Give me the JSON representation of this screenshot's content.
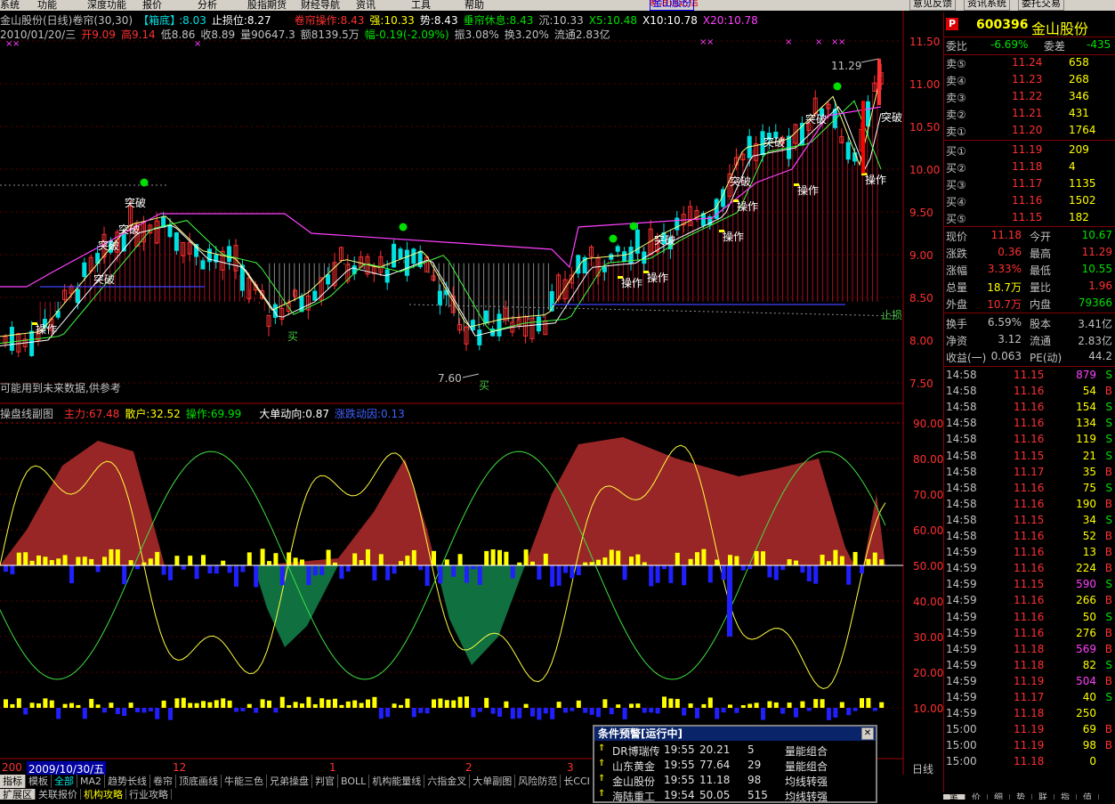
{
  "menu": {
    "items": [
      "系统",
      "功能",
      "深度功能",
      "报价",
      "分析",
      "股指期货",
      "财经导航",
      "资讯",
      "工具",
      "帮助"
    ],
    "center_title": "新浪通达信",
    "center_stock": "金山股份",
    "buttons": [
      "意见反馈",
      "资讯系统",
      "委托交易"
    ]
  },
  "header": {
    "stock_title": "金山股份(日线)",
    "indicator_name": "卷帘(30,30)",
    "box_label": "【箱底】",
    "box_value": ":8.03",
    "stop_loss": "止损位:8.27",
    "op_label": "卷帘操作:8.43",
    "strong": "强:10.33",
    "trend": "势:8.43",
    "rest": "垂帘休息:8.43",
    "sink": "沉:10.33",
    "x5": "X5:10.48",
    "x10": "X10:10.78",
    "x20": "X20:10.78",
    "date": "2010/01/20/三",
    "open": "开9.09",
    "high": "高9.14",
    "low": "低8.86",
    "close": "收8.89",
    "vol": "量90647.3",
    "amount": "额8139.5万",
    "change": "幅-0.19(-2.09%)",
    "amp": "振3.08%",
    "turnover": "换3.20%",
    "float": "流通2.83亿"
  },
  "main_chart": {
    "price_ticks": [
      "11.50",
      "11.00",
      "10.50",
      "10.00",
      "9.50",
      "9.00",
      "8.50",
      "8.00",
      "7.50"
    ],
    "labels": {
      "breakout": "突破",
      "operate": "操作",
      "buy": "买",
      "stop_loss_tag": "止损",
      "high_mark": "11.29",
      "low_mark": "7.60",
      "future_note": "可能用到未来数据,供参考"
    }
  },
  "sub_chart": {
    "title": "操盘线副图",
    "main_force": "主力:67.48",
    "retail": "散户:32.52",
    "operate": "操作:69.99",
    "big_order": "大单动向:0.87",
    "price_momentum": "涨跌动因:0.13",
    "ticks": [
      "90.00",
      "80.00",
      "70.00",
      "60.00",
      "50.00",
      "40.00",
      "30.00",
      "20.00",
      "10.00"
    ]
  },
  "time_axis": {
    "date_label": "2009/10/30/五",
    "left_stub": "200",
    "months": [
      "12",
      "1",
      "2",
      "3"
    ],
    "period": "日线"
  },
  "tabs_row1": [
    "指标",
    "模板",
    "全部",
    "MA2",
    "趋势长线",
    "卷帘",
    "顶底画线",
    "牛能三色",
    "兄弟操盘",
    "判官",
    "BOLL",
    "机构能量线",
    "六指金叉",
    "大单副图",
    "风险防范",
    "长CCI"
  ],
  "tabs_row2": [
    "扩展区",
    "关联报价",
    "机构攻略",
    "行业攻略"
  ],
  "right_panel": {
    "code": "600396",
    "name": "金山股份",
    "wei_bi_label": "委比",
    "wei_bi": "-6.69%",
    "wei_cha_label": "委差",
    "wei_cha": "-435",
    "asks": [
      {
        "label": "卖⑤",
        "price": "11.24",
        "vol": "658"
      },
      {
        "label": "卖④",
        "price": "11.23",
        "vol": "268"
      },
      {
        "label": "卖③",
        "price": "11.22",
        "vol": "346"
      },
      {
        "label": "卖②",
        "price": "11.21",
        "vol": "431"
      },
      {
        "label": "卖①",
        "price": "11.20",
        "vol": "1764"
      }
    ],
    "bids": [
      {
        "label": "买①",
        "price": "11.19",
        "vol": "209"
      },
      {
        "label": "买②",
        "price": "11.18",
        "vol": "4"
      },
      {
        "label": "买③",
        "price": "11.17",
        "vol": "1135"
      },
      {
        "label": "买④",
        "price": "11.16",
        "vol": "1502"
      },
      {
        "label": "买⑤",
        "price": "11.15",
        "vol": "182"
      }
    ],
    "quote": [
      {
        "l1": "现价",
        "v1": "11.18",
        "l2": "今开",
        "v2": "10.67"
      },
      {
        "l1": "涨跌",
        "v1": "0.36",
        "l2": "最高",
        "v2": "11.29"
      },
      {
        "l1": "涨幅",
        "v1": "3.33%",
        "l2": "最低",
        "v2": "10.55"
      },
      {
        "l1": "总量",
        "v1": "18.7万",
        "l2": "量比",
        "v2": "1.96"
      },
      {
        "l1": "外盘",
        "v1": "10.7万",
        "l2": "内盘",
        "v2": "79366"
      }
    ],
    "fund": [
      {
        "l1": "换手",
        "v1": "6.59%",
        "l2": "股本",
        "v2": "3.41亿"
      },
      {
        "l1": "净资",
        "v1": "3.12",
        "l2": "流通",
        "v2": "2.83亿"
      },
      {
        "l1": "收益(一)",
        "v1": "0.063",
        "l2": "PE(动)",
        "v2": "44.2"
      }
    ],
    "ticks": [
      {
        "t": "14:58",
        "p": "11.15",
        "v": "879",
        "s": "S"
      },
      {
        "t": "14:58",
        "p": "11.16",
        "v": "54",
        "s": "B"
      },
      {
        "t": "14:58",
        "p": "11.16",
        "v": "154",
        "s": "S"
      },
      {
        "t": "14:58",
        "p": "11.16",
        "v": "134",
        "s": "S"
      },
      {
        "t": "14:58",
        "p": "11.16",
        "v": "119",
        "s": "S"
      },
      {
        "t": "14:58",
        "p": "11.15",
        "v": "21",
        "s": "S"
      },
      {
        "t": "14:58",
        "p": "11.17",
        "v": "35",
        "s": "B"
      },
      {
        "t": "14:58",
        "p": "11.16",
        "v": "75",
        "s": "S"
      },
      {
        "t": "14:58",
        "p": "11.16",
        "v": "190",
        "s": "B"
      },
      {
        "t": "14:58",
        "p": "11.15",
        "v": "34",
        "s": "S"
      },
      {
        "t": "14:58",
        "p": "11.16",
        "v": "52",
        "s": "B"
      },
      {
        "t": "14:59",
        "p": "11.16",
        "v": "13",
        "s": "B"
      },
      {
        "t": "14:59",
        "p": "11.16",
        "v": "224",
        "s": "B"
      },
      {
        "t": "14:59",
        "p": "11.15",
        "v": "590",
        "s": "S"
      },
      {
        "t": "14:59",
        "p": "11.16",
        "v": "266",
        "s": "B"
      },
      {
        "t": "14:59",
        "p": "11.16",
        "v": "50",
        "s": "S"
      },
      {
        "t": "14:59",
        "p": "11.16",
        "v": "276",
        "s": "B"
      },
      {
        "t": "14:59",
        "p": "11.18",
        "v": "569",
        "s": "B"
      },
      {
        "t": "14:59",
        "p": "11.18",
        "v": "82",
        "s": "S"
      },
      {
        "t": "14:59",
        "p": "11.19",
        "v": "504",
        "s": "B"
      },
      {
        "t": "14:59",
        "p": "11.17",
        "v": "40",
        "s": "S"
      },
      {
        "t": "14:59",
        "p": "11.18",
        "v": "250",
        "s": ""
      },
      {
        "t": "15:00",
        "p": "11.19",
        "v": "69",
        "s": "B"
      },
      {
        "t": "15:00",
        "p": "11.19",
        "v": "98",
        "s": "B"
      },
      {
        "t": "15:00",
        "p": "11.18",
        "v": "0",
        "s": ""
      }
    ],
    "bottom_tabs": [
      "笔",
      "价",
      "细",
      "势",
      "联",
      "指",
      "值"
    ]
  },
  "alert": {
    "title": "条件预警[运行中]",
    "rows": [
      {
        "name": "DR博瑞传",
        "time": "19:55",
        "price": "20.21",
        "num": "5",
        "cond": "量能组合"
      },
      {
        "name": "山东黄金",
        "time": "19:55",
        "price": "77.64",
        "num": "29",
        "cond": "量能组合"
      },
      {
        "name": "金山股份",
        "time": "19:55",
        "price": "11.18",
        "num": "98",
        "cond": "均线转强"
      },
      {
        "name": "海陆重工",
        "time": "19:54",
        "price": "50.05",
        "num": "515",
        "cond": "均线转强"
      }
    ]
  },
  "colors": {
    "bg": "#000000",
    "up": "#ff3030",
    "down": "#00e0e0",
    "grid": "#800000"
  }
}
